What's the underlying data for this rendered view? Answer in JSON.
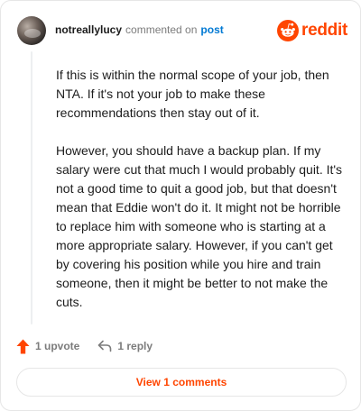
{
  "header": {
    "username": "notreallylucy",
    "action": "commented on",
    "link": "post",
    "brand": "reddit"
  },
  "comment": {
    "paragraphs": [
      "If this is within the normal scope of your job, then NTA. If it's not your job to make these recommendations then stay out of it.",
      "However, you should have a backup plan. If my salary were cut that much I would probably quit. It's not a good time to quit a good job, but that doesn't mean that Eddie won't do it. It might not be horrible to replace him with someone who is starting at a more appropriate salary. However, if you can't get by covering his position while you hire and train someone, then it might be better to not make the cuts."
    ]
  },
  "actions": {
    "upvotes": "1 upvote",
    "replies": "1 reply"
  },
  "footer": {
    "view_comments": "View 1 comments"
  },
  "colors": {
    "brand": "#ff4500",
    "link": "#0079d3",
    "muted": "#7c7c7c"
  },
  "icons": {
    "upvote": "upvote-arrow-icon",
    "reply": "reply-arrow-icon",
    "brand": "reddit-snoo-icon"
  }
}
